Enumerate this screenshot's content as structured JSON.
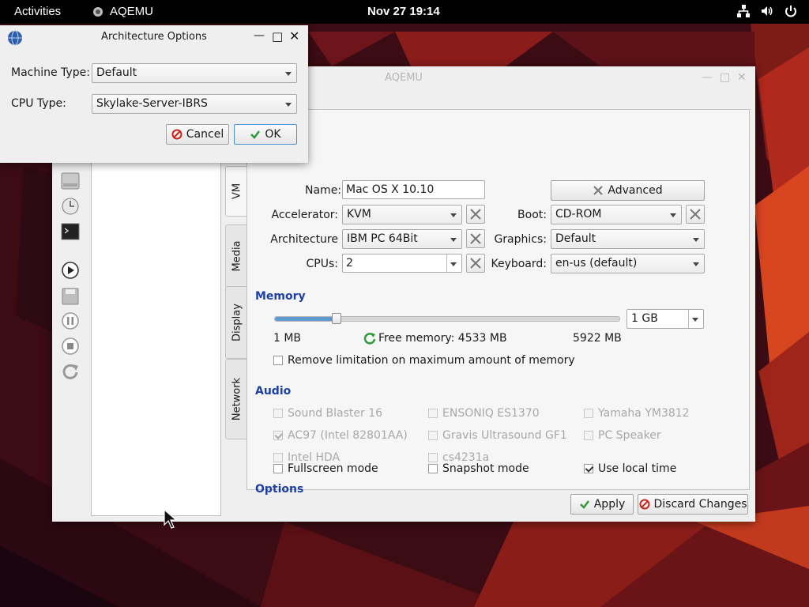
{
  "topbar": {
    "activities": "Activities",
    "app_name": "AQEMU",
    "clock": "Nov 27  19:14",
    "tray_icons": [
      "network-icon",
      "volume-icon",
      "power-icon"
    ]
  },
  "main_window": {
    "title": "AQEMU",
    "tabs": [
      "VM",
      "Media",
      "Display",
      "Network"
    ],
    "vm": {
      "name_label": "Name:",
      "name_value": "Mac OS X 10.10",
      "advanced_label": "Advanced",
      "accelerator_label": "Accelerator:",
      "accelerator_value": "KVM",
      "boot_label": "Boot:",
      "boot_value": "CD-ROM",
      "architecture_label": "Architecture",
      "architecture_value": "IBM PC 64Bit",
      "graphics_label": "Graphics:",
      "graphics_value": "Default",
      "cpus_label": "CPUs:",
      "cpus_value": "2",
      "keyboard_label": "Keyboard:",
      "keyboard_value": "en-us (default)"
    },
    "memory": {
      "section": "Memory",
      "value": "1 GB",
      "slider_fraction": 0.18,
      "min_label": "1 MB",
      "free_label": "Free memory: 4533 MB",
      "max_label": "5922 MB",
      "remove_limit_label": "Remove limitation on maximum amount of memory"
    },
    "audio": {
      "section": "Audio",
      "items": [
        {
          "label": "Sound Blaster 16",
          "checked": false
        },
        {
          "label": "ENSONIQ ES1370",
          "checked": false
        },
        {
          "label": "Yamaha YM3812",
          "checked": false
        },
        {
          "label": "AC97 (Intel 82801AA)",
          "checked": true
        },
        {
          "label": "Gravis Ultrasound GF1",
          "checked": false
        },
        {
          "label": "PC Speaker",
          "checked": false
        },
        {
          "label": "Intel HDA",
          "checked": false
        },
        {
          "label": "cs4231a",
          "checked": false
        }
      ]
    },
    "options": {
      "section": "Options",
      "fullscreen": "Fullscreen mode",
      "snapshot": "Snapshot mode",
      "localtime": "Use local time",
      "localtime_checked": true
    },
    "apply_label": "Apply",
    "discard_label": "Discard Changes"
  },
  "dialog": {
    "title": "Architecture Options",
    "machine_type_label": "Machine Type:",
    "machine_type_value": "Default",
    "cpu_type_label": "CPU Type:",
    "cpu_type_value": "Skylake-Server-IBRS",
    "cancel_label": "Cancel",
    "ok_label": "OK"
  },
  "colors": {
    "section_heading": "#1d3fa8",
    "topbar": "#000000",
    "wallpaper_accent": "#c8261d"
  }
}
